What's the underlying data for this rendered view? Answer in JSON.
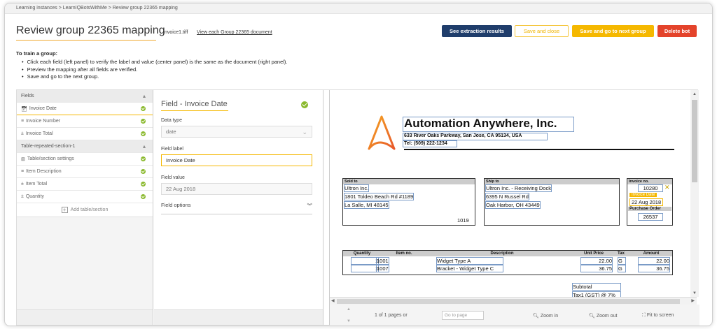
{
  "breadcrumb": "Learning instances  >  LearnIQBotsWithMe  >  Review group 22365 mapping",
  "page": {
    "title": "Review group 22365 mapping",
    "file_name": "Invoice1.tiff",
    "view_docs_link": "View each Group 22365 document"
  },
  "actions": {
    "see_results": "See extraction results",
    "save_close": "Save and close",
    "save_next": "Save and go to next group",
    "delete_bot": "Delete bot"
  },
  "instructions": {
    "heading": "To train a group:",
    "steps": [
      "Click each field (left panel) to verify the label and value (center panel) is the same as the document (right panel).",
      "Preview the mapping after all fields are verified.",
      "Save and go to the next group."
    ]
  },
  "left_panel": {
    "fields_header": "Fields",
    "fields": [
      {
        "label": "Invoice Date",
        "icon": "calendar-icon"
      },
      {
        "label": "Invoice Number",
        "icon": "text-icon"
      },
      {
        "label": "Invoice Total",
        "icon": "number-icon"
      }
    ],
    "table_header": "Table-repeated-section-1",
    "table_items": [
      {
        "label": "Table/section settings",
        "icon": "table-icon"
      },
      {
        "label": "Item Description",
        "icon": "text-icon"
      },
      {
        "label": "Item Total",
        "icon": "number-icon"
      },
      {
        "label": "Quantity",
        "icon": "number-icon"
      }
    ],
    "add_table": "Add table/section"
  },
  "center_panel": {
    "title": "Field - Invoice Date",
    "data_type_label": "Data type",
    "data_type_value": "date",
    "field_label_label": "Field label",
    "field_label_value": "Invoice Date",
    "field_value_label": "Field value",
    "field_value_value": "22 Aug 2018",
    "field_options": "Field options"
  },
  "document": {
    "company": "Automation Anywhere, Inc.",
    "address": "633 River Oaks Parkway, San Jose, CA 95134, USA",
    "tel": "Tel: (509) 222-1234",
    "sold_to_header": "Sold to",
    "sold_to_lines": [
      "Ultron Inc.",
      "1801 Toldeo Beach Rd #1189",
      "La Salle, MI 48145"
    ],
    "sold_to_number": "1019",
    "ship_to_header": "Ship to",
    "ship_to_lines": [
      "Ultron Inc. - Receiving Dock",
      "6395 N Russel Rd",
      "Oak Harbor, OH 43449"
    ],
    "invoice_no_header": "Invoice no.",
    "invoice_no": "10280",
    "invoice_date_tag": "Invoice Date",
    "invoice_date": "22 Aug 2018",
    "po_header": "Purchase Order",
    "po": "26537",
    "table_headers": [
      "Quantity",
      "Item no.",
      "Description",
      "Unit Price",
      "Tax",
      "Amount"
    ],
    "rows": [
      {
        "qty": "1",
        "item": "1001",
        "desc": "Widget Type A",
        "price": "22.00",
        "tax": "G",
        "amount": "22.00"
      },
      {
        "qty": "1",
        "item": "1007",
        "desc": "Bracket - Widget Type C",
        "price": "36.75",
        "tax": "G",
        "amount": "36.75"
      }
    ],
    "subtotal": "Subtotal",
    "tax_line": "Tax1 (GST) @ 7%"
  },
  "viewer_bar": {
    "pages": "1 of 1 pages or",
    "goto_placeholder": "Go to page",
    "zoom_in": "Zoom in",
    "zoom_out": "Zoom out",
    "fit": "Fit to screen"
  },
  "colors": {
    "primary_navy": "#1f3d6b",
    "accent_yellow": "#f5b800",
    "danger_red": "#e4432b",
    "ok_green": "#8ab92d"
  }
}
